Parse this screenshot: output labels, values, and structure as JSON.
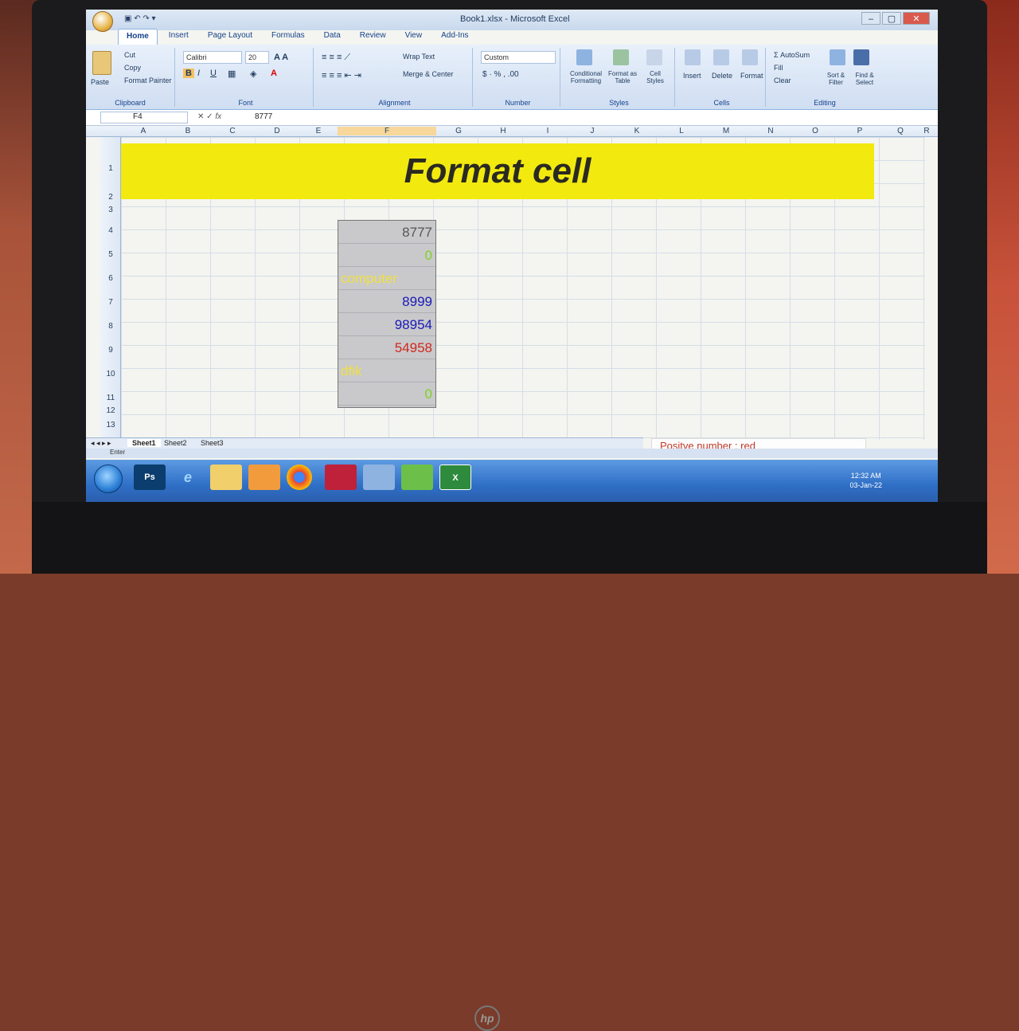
{
  "window": {
    "title": "Book1.xlsx - Microsoft Excel"
  },
  "ribbon": {
    "tabs": [
      "Home",
      "Insert",
      "Page Layout",
      "Formulas",
      "Data",
      "Review",
      "View",
      "Add-Ins"
    ],
    "clipboard": {
      "paste": "Paste",
      "cut": "Cut",
      "copy": "Copy",
      "format_painter": "Format Painter",
      "label": "Clipboard"
    },
    "font": {
      "name": "Calibri",
      "size": "20",
      "label": "Font"
    },
    "alignment": {
      "wrap_text": "Wrap Text",
      "merge_center": "Merge & Center",
      "label": "Alignment"
    },
    "number": {
      "format": "Custom",
      "label": "Number"
    },
    "styles": {
      "conditional": "Conditional Formatting",
      "format_table": "Format as Table",
      "cell_styles": "Cell Styles",
      "label": "Styles"
    },
    "cells": {
      "insert": "Insert",
      "delete": "Delete",
      "format": "Format",
      "label": "Cells"
    },
    "editing": {
      "autosum": "AutoSum",
      "fill": "Fill",
      "clear": "Clear",
      "sort": "Sort & Filter",
      "find": "Find & Select",
      "label": "Editing"
    }
  },
  "formula_bar": {
    "name_box": "F4",
    "fx": "fx",
    "value": "8777"
  },
  "columns": [
    "A",
    "B",
    "C",
    "D",
    "E",
    "F",
    "G",
    "H",
    "I",
    "J",
    "K",
    "L",
    "M",
    "N",
    "O",
    "P",
    "Q",
    "R"
  ],
  "rows": [
    "1",
    "2",
    "3",
    "4",
    "5",
    "6",
    "7",
    "8",
    "9",
    "10",
    "11",
    "12",
    "13"
  ],
  "banner": {
    "text": "Format cell",
    "color": "#f2ea0f"
  },
  "cells": [
    {
      "row": "4",
      "text": "8777",
      "color": "#555555",
      "align": "num"
    },
    {
      "row": "5",
      "text": "0",
      "color": "#7ed321",
      "align": "num"
    },
    {
      "row": "6",
      "text": "computer",
      "color": "#f0e040",
      "align": "txt"
    },
    {
      "row": "7",
      "text": "8999",
      "color": "#1a1ab8",
      "align": "num"
    },
    {
      "row": "8",
      "text": "98954",
      "color": "#1a1ab8",
      "align": "num"
    },
    {
      "row": "9",
      "text": "54958",
      "color": "#d0281c",
      "align": "num"
    },
    {
      "row": "10",
      "text": "dfik",
      "color": "#f0e040",
      "align": "txt"
    },
    {
      "row": "11",
      "text": "0",
      "color": "#7ed321",
      "align": "num"
    }
  ],
  "note": "Positve number : red",
  "sheets": [
    "Sheet1",
    "Sheet2",
    "Sheet3"
  ],
  "status": "Enter",
  "taskbar": {
    "apps": [
      "Ps",
      "e",
      "",
      "",
      "",
      "",
      "",
      "",
      "X"
    ]
  },
  "clock": {
    "time": "12:32 AM",
    "date": "03-Jan-22"
  },
  "brand": "hp"
}
